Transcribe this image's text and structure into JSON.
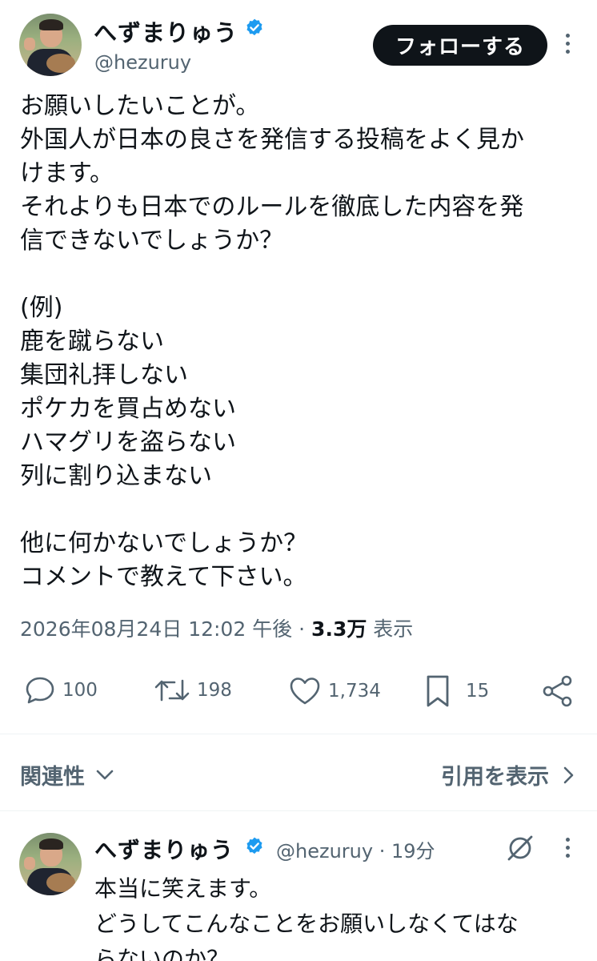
{
  "tweet": {
    "author_name": "へずまりゅう",
    "author_handle": "@hezuruy",
    "follow_label": "フォローする",
    "lines": [
      "お願いしたいことが。",
      "外国人が日本の良さを発信する投稿をよく見か",
      "けます。",
      "それよりも日本でのルールを徹底した内容を発",
      "信できないでしょうか？",
      "",
      "(例)",
      "鹿を蹴らない",
      "集団礼拝しない",
      "ポケカを買占めない",
      "ハマグリを盗らない",
      "列に割り込まない",
      "",
      "他に何かないでしょうか？",
      "コメントで教えて下さい。"
    ],
    "timestamp": "2026年08月24日 12:02 午後",
    "separator": "·",
    "views_count": "3.3万",
    "views_label": "表示",
    "stats": {
      "replies": "100",
      "retweets": "198",
      "likes": "1,734",
      "bookmarks": "15"
    }
  },
  "replies_bar": {
    "sort_label": "関連性",
    "quotes_label": "引用を表示"
  },
  "reply": {
    "author_name": "へずまりゅう",
    "author_handle": "@hezuruy",
    "separator": "·",
    "time_ago": "19分",
    "lines": [
      "本当に笑えます。",
      "どうしてこんなことをお願いしなくてはな",
      "らないのか？"
    ]
  },
  "icons": {
    "verified": "verified-badge-icon",
    "more": "more-vertical-icon",
    "reply": "reply-icon",
    "retweet": "retweet-icon",
    "like": "heart-icon",
    "bookmark": "bookmark-icon",
    "share": "share-icon",
    "chevron_down": "chevron-down-icon",
    "chevron_right": "chevron-right-icon",
    "grok": "grok-icon"
  },
  "colors": {
    "verified_blue": "#1d9bf0",
    "text_primary": "#0f1419",
    "text_secondary": "#536471",
    "follow_bg": "#0f1419"
  }
}
